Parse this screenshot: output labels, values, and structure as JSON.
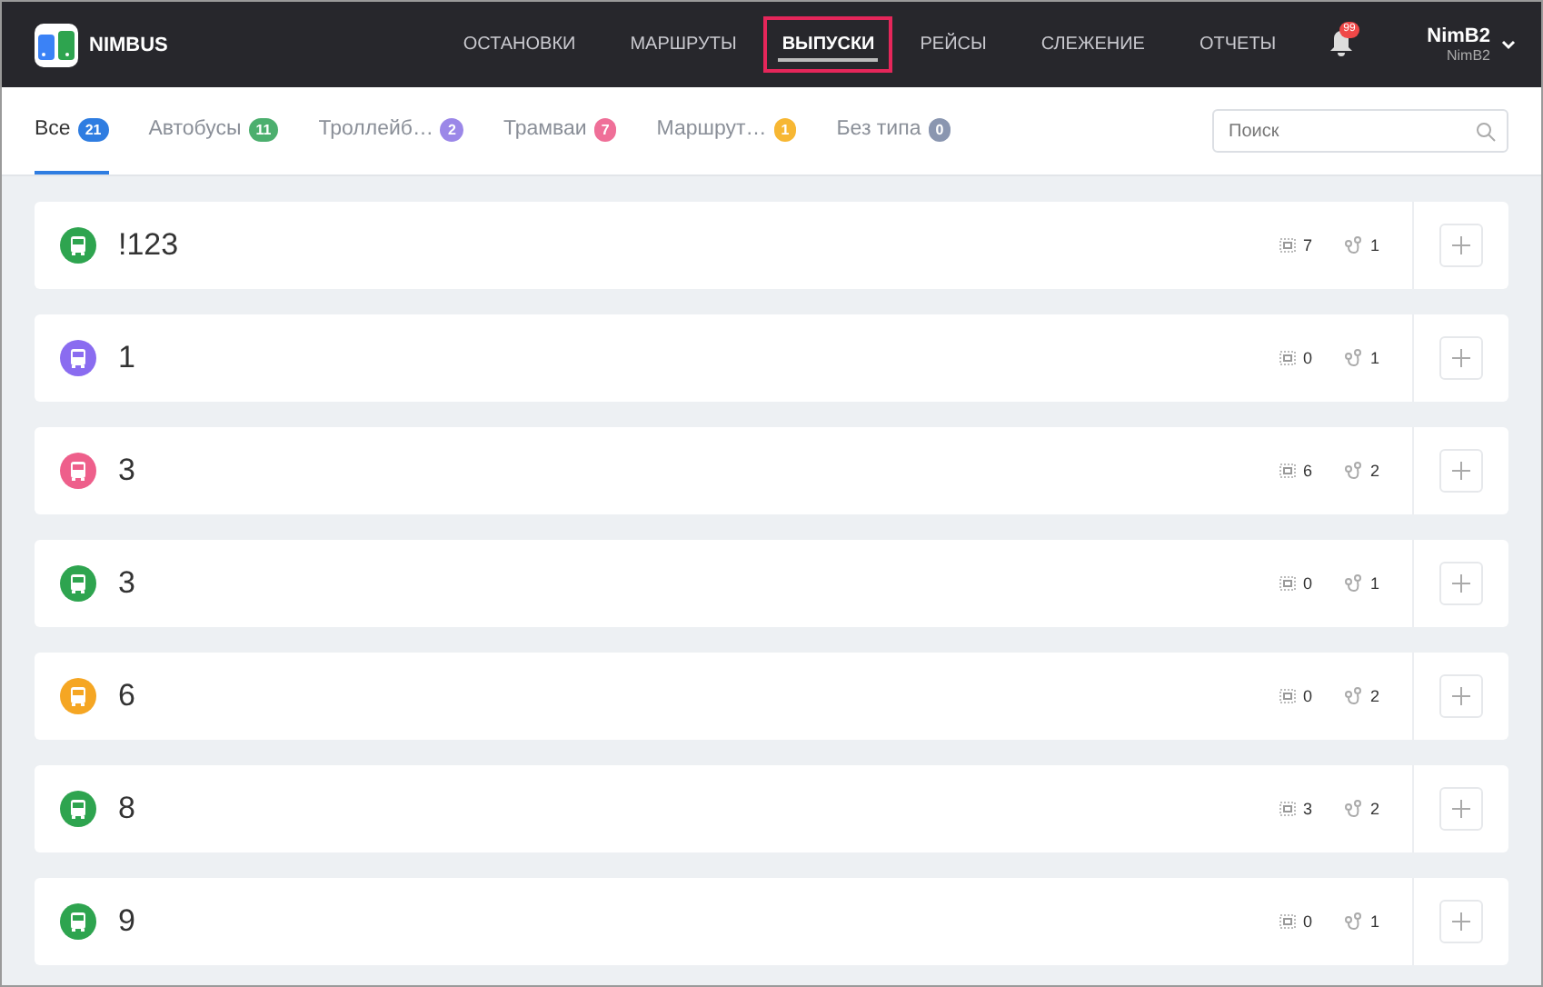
{
  "header": {
    "logo": "NIMBUS",
    "nav": [
      {
        "label": "ОСТАНОВКИ",
        "selected": false
      },
      {
        "label": "МАРШРУТЫ",
        "selected": false
      },
      {
        "label": "ВЫПУСКИ",
        "selected": true
      },
      {
        "label": "РЕЙСЫ",
        "selected": false
      },
      {
        "label": "СЛЕЖЕНИЕ",
        "selected": false
      },
      {
        "label": "ОТЧЕТЫ",
        "selected": false
      }
    ],
    "notifications": "99",
    "user": {
      "name": "NimB2",
      "login": "NimB2"
    }
  },
  "tabs": [
    {
      "label": "Все",
      "count": "21",
      "color": "#2f7de1",
      "selected": true
    },
    {
      "label": "Автобусы",
      "count": "11",
      "color": "#4caf6e",
      "selected": false
    },
    {
      "label": "Троллейб…",
      "count": "2",
      "color": "#9b87e8",
      "selected": false
    },
    {
      "label": "Трамваи",
      "count": "7",
      "color": "#ef6f98",
      "selected": false
    },
    {
      "label": "Маршрут…",
      "count": "1",
      "color": "#f7b733",
      "selected": false
    },
    {
      "label": "Без типа",
      "count": "0",
      "color": "#8a96b0",
      "selected": false
    }
  ],
  "search": {
    "placeholder": "Поиск"
  },
  "rows": [
    {
      "name": "!123",
      "color": "#2ea44f",
      "vehicles": "7",
      "routes": "1"
    },
    {
      "name": "1",
      "color": "#8a6cf0",
      "vehicles": "0",
      "routes": "1"
    },
    {
      "name": "3",
      "color": "#ee5f8b",
      "vehicles": "6",
      "routes": "2"
    },
    {
      "name": "3",
      "color": "#2ea44f",
      "vehicles": "0",
      "routes": "1"
    },
    {
      "name": "6",
      "color": "#f5a623",
      "vehicles": "0",
      "routes": "2"
    },
    {
      "name": "8",
      "color": "#2ea44f",
      "vehicles": "3",
      "routes": "2"
    },
    {
      "name": "9",
      "color": "#2ea44f",
      "vehicles": "0",
      "routes": "1"
    }
  ]
}
